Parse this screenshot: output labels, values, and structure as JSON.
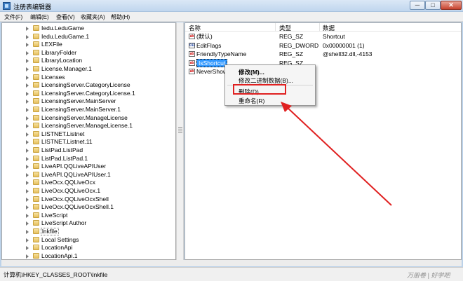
{
  "window": {
    "title": "注册表编辑器",
    "minimize": "─",
    "maximize": "□",
    "close": "✕"
  },
  "menu": [
    "文件(F)",
    "编辑(E)",
    "查看(V)",
    "收藏夹(A)",
    "帮助(H)"
  ],
  "tree": {
    "items": [
      "Iedu.LeduGame",
      "Iedu.LeduGame.1",
      "LEXFile",
      "LibraryFolder",
      "LibraryLocation",
      "License.Manager.1",
      "Licenses",
      "LicensingServer.CategoryLicense",
      "LicensingServer.CategoryLicense.1",
      "LicensingServer.MainServer",
      "LicensingServer.MainServer.1",
      "LicensingServer.ManageLicense",
      "LicensingServer.ManageLicense.1",
      "LISTNET.Listnet",
      "LISTNET.Listnet.11",
      "ListPad.ListPad",
      "ListPad.ListPad.1",
      "LiveAPI.QQLiveAPIUser",
      "LiveAPI.QQLiveAPIUser.1",
      "LiveOcx.QQLiveOcx",
      "LiveOcx.QQLiveOcx.1",
      "LiveOcx.QQLiveOcxShell",
      "LiveOcx.QQLiveOcxShell.1",
      "LiveScript",
      "LiveScript Author",
      "lnkfile",
      "Local Settings",
      "LocationApi",
      "LocationApi.1"
    ]
  },
  "list": {
    "headers": {
      "name": "名称",
      "type": "类型",
      "data": "数据"
    },
    "rows": [
      {
        "name": "(默认)",
        "type": "REG_SZ",
        "data": "Shortcut",
        "icon": "ab"
      },
      {
        "name": "EditFlags",
        "type": "REG_DWORD",
        "data": "0x00000001 (1)",
        "icon": "bin"
      },
      {
        "name": "FriendlyTypeName",
        "type": "REG_SZ",
        "data": "@shell32.dll,-4153",
        "icon": "ab"
      },
      {
        "name": "IsShortcut",
        "type": "REG_SZ",
        "data": "",
        "icon": "ab"
      },
      {
        "name": "NeverShowExt",
        "type": "",
        "data": "",
        "icon": "ab"
      }
    ]
  },
  "context_menu": {
    "modify": "修改(M)...",
    "modify_binary": "修改二进制数据(B)...",
    "delete": "删除(D)",
    "rename": "重命名(R)"
  },
  "status": {
    "path": "计算机\\HKEY_CLASSES_ROOT\\lnkfile",
    "watermark": "万册卷 | 好学吧"
  },
  "colors": {
    "highlight_box": "#e02020",
    "arrow": "#e02020",
    "selection": "#3399ff"
  }
}
